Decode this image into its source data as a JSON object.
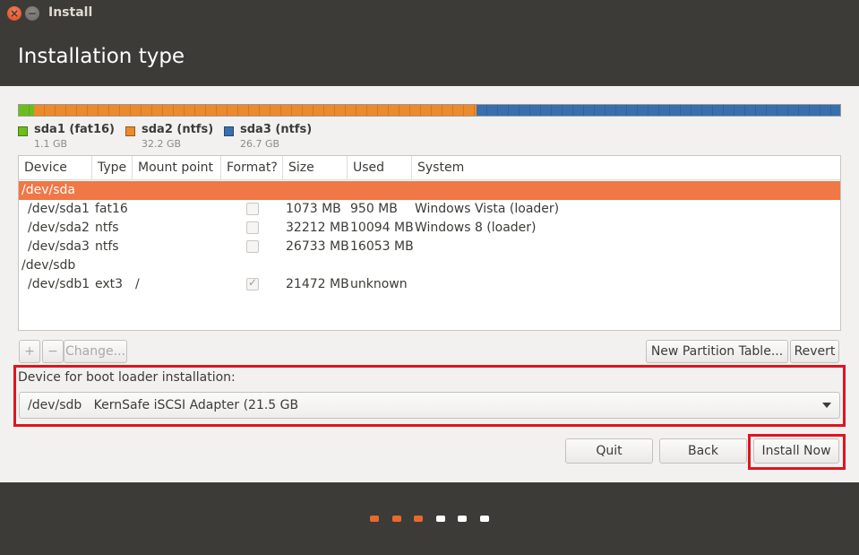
{
  "window": {
    "title": "Install"
  },
  "header": {
    "title": "Installation type"
  },
  "partitions": [
    {
      "name": "sda1 (fat16)",
      "size": "1.1 GB",
      "color": "#6bbe1d"
    },
    {
      "name": "sda2 (ntfs)",
      "size": "32.2 GB",
      "color": "#ec8a2c"
    },
    {
      "name": "sda3 (ntfs)",
      "size": "26.7 GB",
      "color": "#3a6fae"
    }
  ],
  "table": {
    "columns": [
      "Device",
      "Type",
      "Mount point",
      "Format?",
      "Size",
      "Used",
      "System"
    ],
    "rows": [
      {
        "device": "/dev/sda",
        "selected": true
      },
      {
        "device": "/dev/sda1",
        "type": "fat16",
        "mount": "",
        "format": false,
        "size": "1073 MB",
        "used": "950 MB",
        "system": "Windows Vista (loader)"
      },
      {
        "device": "/dev/sda2",
        "type": "ntfs",
        "mount": "",
        "format": false,
        "size": "32212 MB",
        "used": "10094 MB",
        "system": "Windows 8 (loader)"
      },
      {
        "device": "/dev/sda3",
        "type": "ntfs",
        "mount": "",
        "format": false,
        "size": "26733 MB",
        "used": "16053 MB",
        "system": ""
      },
      {
        "device": "/dev/sdb"
      },
      {
        "device": "/dev/sdb1",
        "type": "ext3",
        "mount": "/",
        "format": true,
        "size": "21472 MB",
        "used": "unknown",
        "system": ""
      }
    ]
  },
  "table_actions": {
    "add": "+",
    "remove": "−",
    "change": "Change...",
    "new_table": "New Partition Table...",
    "revert": "Revert"
  },
  "bootloader": {
    "label": "Device for boot loader installation:",
    "value": "/dev/sdb   KernSafe iSCSI Adapter (21.5 GB"
  },
  "buttons": {
    "quit": "Quit",
    "back": "Back",
    "install": "Install Now"
  },
  "progress": {
    "total_steps": 6,
    "completed_steps": 3,
    "done_color": "#e9692c",
    "todo_color": "#ffffff"
  },
  "colors": {
    "accent": "#f07746",
    "highlight_box": "#e0141e"
  }
}
